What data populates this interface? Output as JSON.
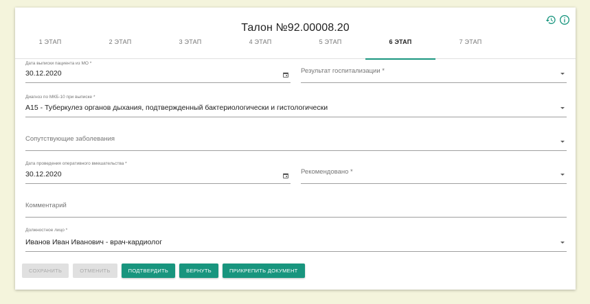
{
  "ticket": {
    "title": "Талон №92.00008.20"
  },
  "tabs": [
    {
      "label": "1 этап"
    },
    {
      "label": "2 этап"
    },
    {
      "label": "3 этап"
    },
    {
      "label": "4 этап"
    },
    {
      "label": "5 этап"
    },
    {
      "label": "6 этап",
      "active": true
    },
    {
      "label": "7 этап"
    }
  ],
  "icons": {
    "history": "history-icon",
    "info": "info-icon",
    "calendar": "calendar-icon",
    "dropdown": "chevron-down-icon"
  },
  "form": {
    "discharge_date": {
      "label": "Дата выписки пациента из МО *",
      "value": "30.12.2020"
    },
    "hospitalization_result": {
      "placeholder": "Результат госпитализации *"
    },
    "diagnosis": {
      "label": "Диагноз по МКБ-10 при выписке *",
      "value": "A15 - Туберкулез органов дыхания, подтвержденный бактериологически и гистологически"
    },
    "comorbidities": {
      "placeholder": "Сопутствующие заболевания"
    },
    "surgery_date": {
      "label": "Дата проведения оперативного вмешательства *",
      "value": "30.12.2020"
    },
    "recommended": {
      "placeholder": "Рекомендовано *"
    },
    "comment": {
      "placeholder": "Комментарий"
    },
    "official": {
      "label": "Должностное лицо *",
      "value": "Иванов  Иван  Иванович  - врач-кардиолог"
    }
  },
  "buttons": {
    "save": "Сохранить",
    "cancel": "Отменить",
    "confirm": "Подтвердить",
    "return": "Вернуть",
    "attach": "Прикрепить документ"
  },
  "colors": {
    "accent": "#18957e",
    "background": "#f4f4dc",
    "disabled": "#e0e0e0"
  }
}
